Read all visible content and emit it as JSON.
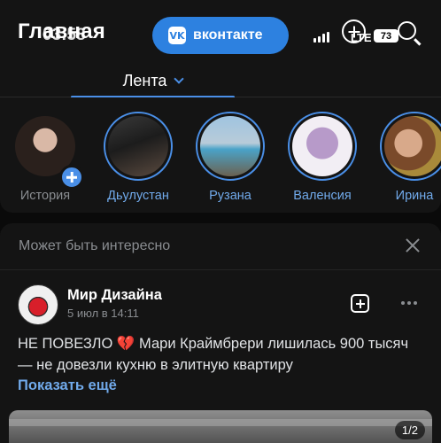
{
  "header": {
    "title": "Главная",
    "clock": "03:58",
    "service_button_label": "вконтакте",
    "service_logo_text": "VK",
    "network": "LTE",
    "battery": "73"
  },
  "tabs": {
    "active_label": "Лента"
  },
  "stories": [
    {
      "name": "История",
      "is_mine": true
    },
    {
      "name": "Дьулустан",
      "is_mine": false
    },
    {
      "name": "Рузана",
      "is_mine": false
    },
    {
      "name": "Валенсия",
      "is_mine": false
    },
    {
      "name": "Ирина",
      "is_mine": false
    }
  ],
  "recommendations": {
    "title": "Может быть интересно"
  },
  "post": {
    "author": "Мир Дизайна",
    "date": "5 июл в 14:11",
    "text_before_emoji": "НЕ ПОВЕЗЛО",
    "emoji": "💔",
    "text_after_emoji": "Мари Краймбрери лишилась 900 тысяч — не довезли кухню в элитную квартиру",
    "show_more": "Показать ещё",
    "image_counter": "1/2"
  },
  "colors": {
    "accent": "#2d81e0",
    "link": "#71aaeb",
    "background": "#0a0a0a",
    "card": "#141414",
    "muted": "#8a8d91"
  }
}
